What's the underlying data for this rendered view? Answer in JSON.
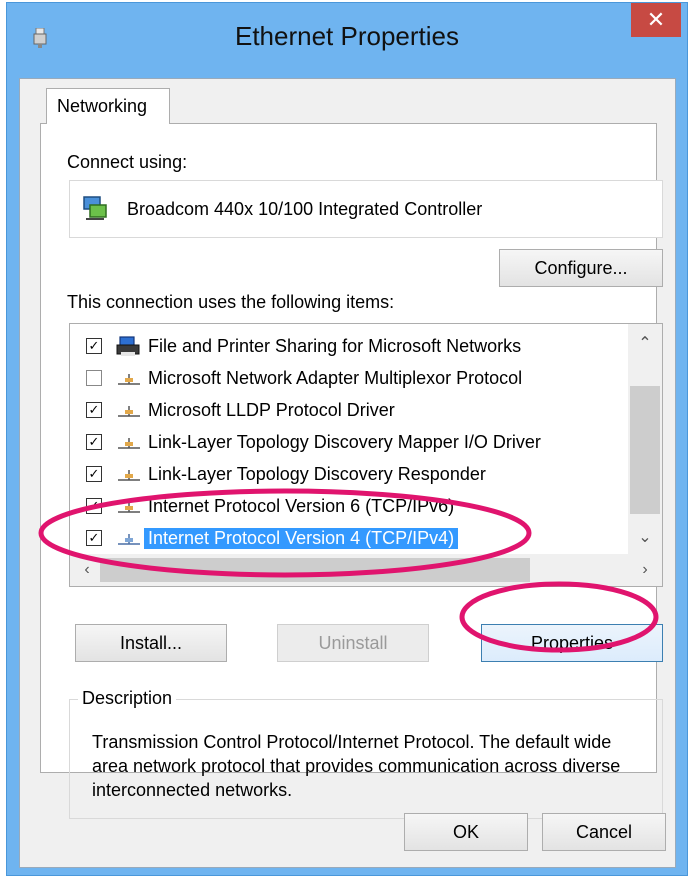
{
  "window": {
    "title": "Ethernet Properties",
    "close_label": "✕"
  },
  "tabs": [
    {
      "label": "Networking",
      "active": true
    }
  ],
  "connect_using": {
    "label": "Connect using:",
    "adapter": "Broadcom 440x 10/100 Integrated Controller",
    "configure_label": "Configure..."
  },
  "items_label": "This connection uses the following items:",
  "items": [
    {
      "label": "File and Printer Sharing for Microsoft Networks",
      "checked": true,
      "icon": "printer-share-icon"
    },
    {
      "label": "Microsoft Network Adapter Multiplexor Protocol",
      "checked": false,
      "icon": "protocol-icon"
    },
    {
      "label": "Microsoft LLDP Protocol Driver",
      "checked": true,
      "icon": "protocol-icon"
    },
    {
      "label": "Link-Layer Topology Discovery Mapper I/O Driver",
      "checked": true,
      "icon": "protocol-icon"
    },
    {
      "label": "Link-Layer Topology Discovery Responder",
      "checked": true,
      "icon": "protocol-icon"
    },
    {
      "label": "Internet Protocol Version 6 (TCP/IPv6)",
      "checked": true,
      "icon": "protocol-icon"
    },
    {
      "label": "Internet Protocol Version 4 (TCP/IPv4)",
      "checked": true,
      "icon": "protocol-icon",
      "selected": true
    }
  ],
  "buttons": {
    "install": "Install...",
    "uninstall": "Uninstall",
    "properties": "Properties",
    "ok": "OK",
    "cancel": "Cancel"
  },
  "description": {
    "title": "Description",
    "text": "Transmission Control Protocol/Internet Protocol. The default wide area network protocol that provides communication across diverse interconnected networks."
  },
  "colors": {
    "titlebar": "#6fb4f0",
    "close_button": "#c74a43",
    "selection": "#3399ff",
    "annotation": "#e0146e"
  }
}
